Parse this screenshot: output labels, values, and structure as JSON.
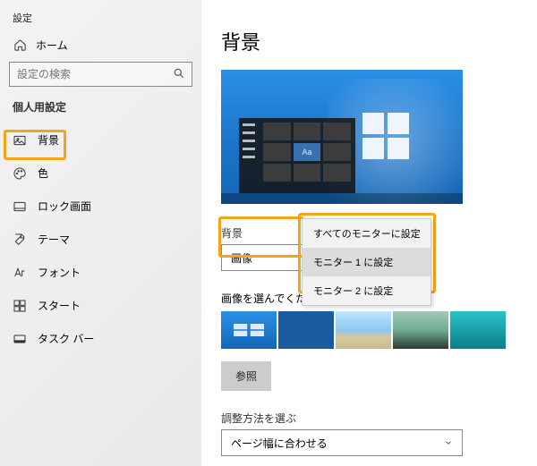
{
  "window": {
    "title": "設定"
  },
  "sidebar": {
    "home": "ホーム",
    "search_placeholder": "設定の検索",
    "section": "個人用設定",
    "items": [
      {
        "label": "背景"
      },
      {
        "label": "色"
      },
      {
        "label": "ロック画面"
      },
      {
        "label": "テーマ"
      },
      {
        "label": "フォント"
      },
      {
        "label": "スタート"
      },
      {
        "label": "タスク バー"
      }
    ]
  },
  "main": {
    "title": "背景",
    "preview_sample": "Aa",
    "bg_label": "背景",
    "bg_value": "画像",
    "context_menu": [
      "すべてのモニターに設定",
      "モニター 1 に設定",
      "モニター 2 に設定"
    ],
    "choose_label": "画像を選んでください",
    "browse": "参照",
    "fit_label": "調整方法を選ぶ",
    "fit_value": "ページ幅に合わせる"
  }
}
